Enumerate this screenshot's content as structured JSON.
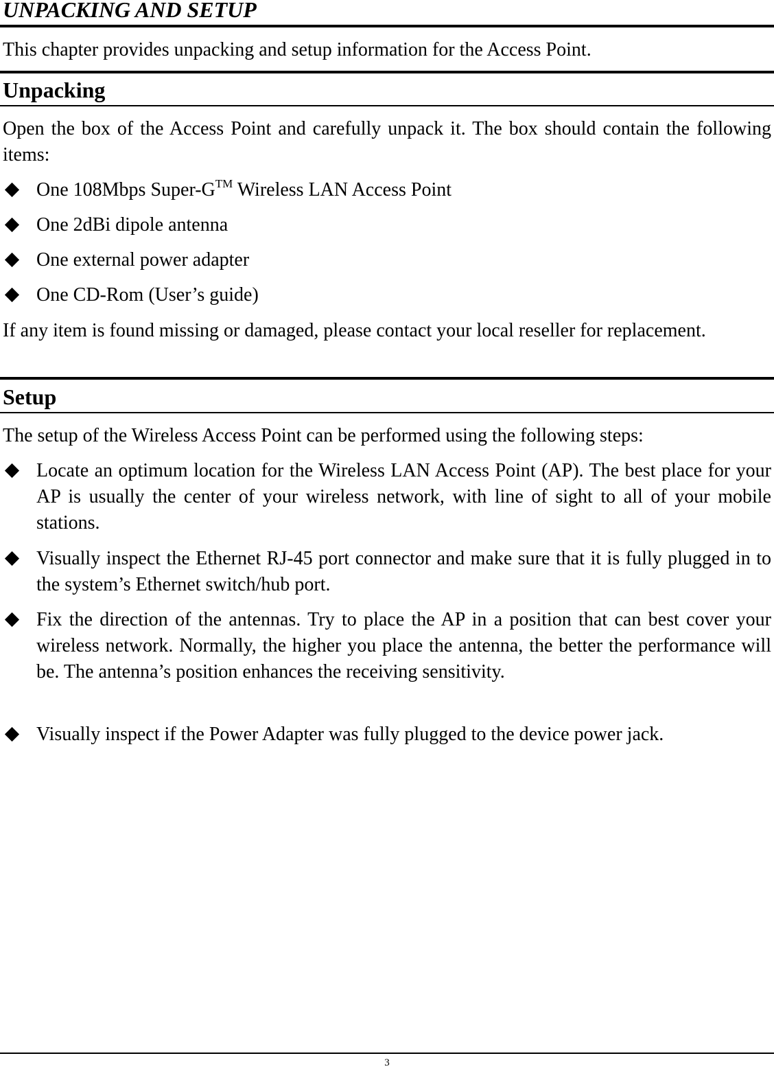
{
  "document": {
    "title": "UNPACKING AND SETUP",
    "intro": "This chapter provides unpacking and setup information for the Access Point.",
    "sections": {
      "unpacking": {
        "heading": "Unpacking",
        "intro": "Open the box of the Access Point and carefully unpack it. The box should contain the following items:",
        "items": [
          {
            "text_before": "One 108Mbps Super-G",
            "superscript": "TM",
            "text_after": " Wireless LAN Access Point"
          },
          {
            "text": "One 2dBi dipole antenna"
          },
          {
            "text": "One external power adapter"
          },
          {
            "text": "One CD-Rom (User’s guide)"
          }
        ],
        "note": "If any item is found missing or damaged, please contact your local reseller for replacement."
      },
      "setup": {
        "heading": "Setup",
        "intro": "The setup of the Wireless Access Point can be performed using the following steps:",
        "steps": [
          "Locate an optimum location for the Wireless LAN Access Point (AP). The best place for your AP is usually the center of your wireless network, with line of sight to all of your mobile stations.",
          "Visually inspect the Ethernet RJ-45 port connector and make sure that it is fully plugged in to the system’s Ethernet switch/hub port.",
          "Fix the direction of the antennas. Try to place the AP in a position that can best cover your wireless network. Normally, the higher you place the antenna, the better the performance will be. The antenna’s position enhances the receiving sensitivity.",
          "Visually inspect if the Power Adapter was fully plugged to the device power jack."
        ]
      }
    },
    "footer": {
      "page_number": "3"
    }
  }
}
